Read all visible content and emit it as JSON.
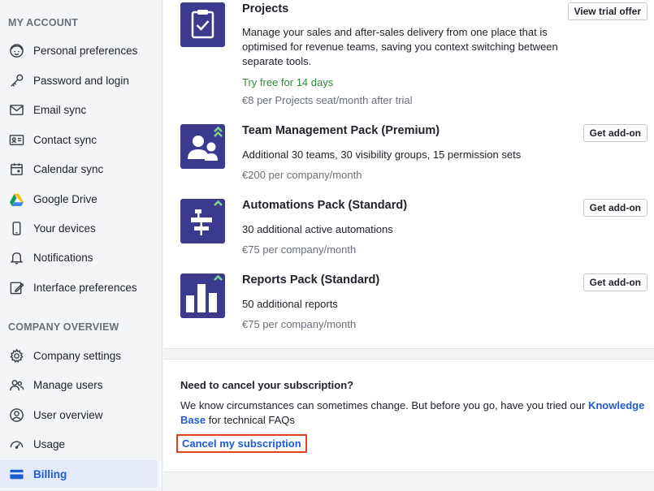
{
  "sidebar": {
    "my_account_title": "MY ACCOUNT",
    "company_overview_title": "COMPANY OVERVIEW",
    "my_account_items": [
      {
        "label": "Personal preferences",
        "icon": "face-icon"
      },
      {
        "label": "Password and login",
        "icon": "key-icon"
      },
      {
        "label": "Email sync",
        "icon": "envelope-icon"
      },
      {
        "label": "Contact sync",
        "icon": "contact-card-icon"
      },
      {
        "label": "Calendar sync",
        "icon": "calendar-icon"
      },
      {
        "label": "Google Drive",
        "icon": "google-drive-icon"
      },
      {
        "label": "Your devices",
        "icon": "phone-icon"
      },
      {
        "label": "Notifications",
        "icon": "bell-icon"
      },
      {
        "label": "Interface preferences",
        "icon": "edit-icon"
      }
    ],
    "company_items": [
      {
        "label": "Company settings",
        "icon": "gear-icon"
      },
      {
        "label": "Manage users",
        "icon": "users-icon"
      },
      {
        "label": "User overview",
        "icon": "user-circle-icon"
      },
      {
        "label": "Usage",
        "icon": "gauge-icon"
      },
      {
        "label": "Billing",
        "icon": "card-icon",
        "active": true
      }
    ]
  },
  "addons": [
    {
      "title": "Projects",
      "description": "Manage your sales and after-sales delivery from one place that is optimised for revenue teams, saving you context switching between separate tools.",
      "trial": "Try free for 14 days",
      "price": "€8 per Projects seat/month after trial",
      "button": "View trial offer",
      "icon": "clipboard-check-icon"
    },
    {
      "title": "Team Management Pack (Premium)",
      "description": "Additional 30 teams, 30 visibility groups, 15 permission sets",
      "price": "€200 per company/month",
      "button": "Get add-on",
      "icon": "team-icon"
    },
    {
      "title": "Automations Pack (Standard)",
      "description": "30 additional active automations",
      "price": "€75 per company/month",
      "button": "Get add-on",
      "icon": "workflow-icon"
    },
    {
      "title": "Reports Pack (Standard)",
      "description": "50 additional reports",
      "price": "€75 per company/month",
      "button": "Get add-on",
      "icon": "bar-chart-icon"
    }
  ],
  "cancel": {
    "title": "Need to cancel your subscription?",
    "text_before": "We know circumstances can sometimes change. But before you go, have you tried our ",
    "link_text": "Knowledge Base",
    "text_after": " for technical FAQs",
    "cancel_link": "Cancel my subscription"
  },
  "colors": {
    "accent": "#1f5cd1",
    "addon_icon_bg": "#3b3a8f",
    "trial_green": "#2e8a3b",
    "highlight_border": "#e2421f",
    "active_bg": "#e3ebfb"
  }
}
